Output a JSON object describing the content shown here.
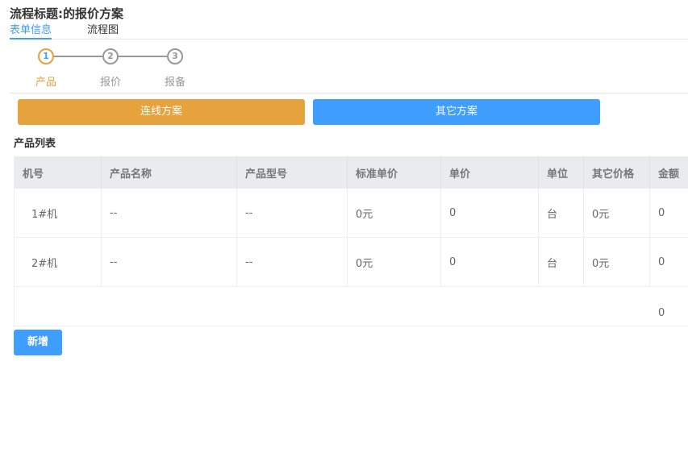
{
  "header": {
    "title": "流程标题:的报价方案"
  },
  "tabs": [
    {
      "label": "表单信息",
      "active": true
    },
    {
      "label": "流程图",
      "active": false
    }
  ],
  "steps": [
    {
      "number": "1",
      "label": "产品",
      "active": true
    },
    {
      "number": "2",
      "label": "报价",
      "active": false
    },
    {
      "number": "3",
      "label": "报备",
      "active": false
    }
  ],
  "scheme_buttons": {
    "primary": "连线方案",
    "secondary": "其它方案"
  },
  "product_section": {
    "title": "产品列表",
    "columns": [
      "机号",
      "产品名称",
      "产品型号",
      "标准单价",
      "单价",
      "单位",
      "其它价格",
      "金额"
    ],
    "rows": [
      [
        "1#机",
        "--",
        "--",
        "0元",
        "0",
        "台",
        "0元",
        "0"
      ],
      [
        "2#机",
        "--",
        "--",
        "0元",
        "0",
        "台",
        "0元",
        "0"
      ]
    ],
    "total": "0"
  },
  "actions": {
    "add_label": "新增"
  },
  "colors": {
    "accent": "#409eff",
    "warning": "#e6a23c",
    "header_bg": "#e9ebef"
  }
}
